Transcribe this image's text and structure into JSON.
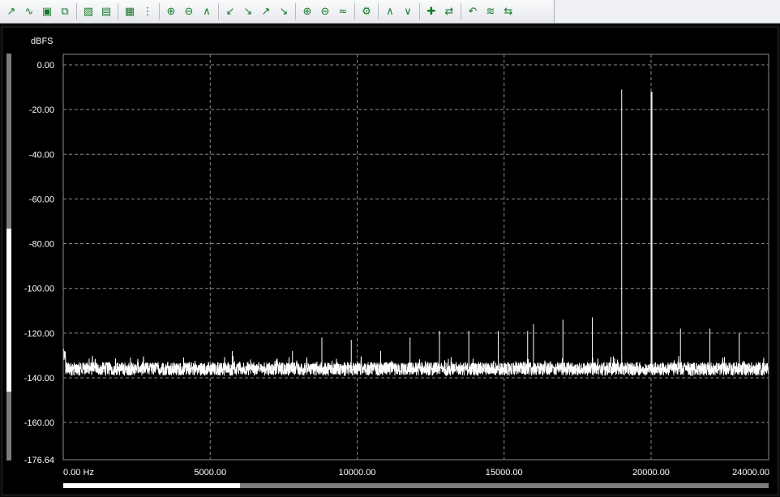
{
  "toolbar": {
    "buttons": [
      {
        "name": "add-trace-icon",
        "glyph": "↗"
      },
      {
        "name": "wave-icon",
        "glyph": "∿"
      },
      {
        "name": "save-icon",
        "glyph": "▣"
      },
      {
        "name": "copy-icon",
        "glyph": "⧉"
      },
      {
        "sep": true
      },
      {
        "name": "chart-view-icon",
        "glyph": "▨"
      },
      {
        "name": "print-icon",
        "glyph": "▤"
      },
      {
        "sep": true
      },
      {
        "name": "table-icon",
        "glyph": "▦"
      },
      {
        "name": "numeric-icon",
        "glyph": "⋮"
      },
      {
        "sep": true
      },
      {
        "name": "zoom-in-icon",
        "glyph": "⊕"
      },
      {
        "name": "zoom-out-icon",
        "glyph": "⊖"
      },
      {
        "name": "fit-icon",
        "glyph": "∧"
      },
      {
        "sep": true
      },
      {
        "name": "cursor-left-icon",
        "glyph": "↙"
      },
      {
        "name": "cursor-down-icon",
        "glyph": "↘"
      },
      {
        "name": "cursor-up-icon",
        "glyph": "↗"
      },
      {
        "name": "cursor-right-icon",
        "glyph": "↘"
      },
      {
        "sep": true
      },
      {
        "name": "zoom-x-icon",
        "glyph": "⊕"
      },
      {
        "name": "zoom-y-icon",
        "glyph": "⊖"
      },
      {
        "name": "autoscale-icon",
        "glyph": "≈"
      },
      {
        "sep": true
      },
      {
        "name": "settings-icon",
        "glyph": "⚙"
      },
      {
        "sep": true
      },
      {
        "name": "peak-icon",
        "glyph": "∧"
      },
      {
        "name": "valley-icon",
        "glyph": "∨"
      },
      {
        "sep": true
      },
      {
        "name": "reset-icon",
        "glyph": "✚"
      },
      {
        "name": "swap-icon",
        "glyph": "⇄"
      },
      {
        "sep": true
      },
      {
        "name": "undo-icon",
        "glyph": "↶"
      },
      {
        "name": "average-icon",
        "glyph": "≋"
      },
      {
        "name": "exchange-icon",
        "glyph": "⇆"
      }
    ]
  },
  "scroll": {
    "vertical_thumb": [
      0.43,
      0.83
    ],
    "horizontal_thumb": [
      0.0,
      0.25
    ]
  },
  "chart_data": {
    "type": "line",
    "title": "",
    "ylabel": "dBFS",
    "xunit": "Hz",
    "xlim": [
      0,
      24000
    ],
    "ylim": [
      -176.64,
      0
    ],
    "yticks": [
      0,
      -20,
      -40,
      -60,
      -80,
      -100,
      -120,
      -140,
      -160,
      -176.64
    ],
    "ytick_labels": [
      "0.00",
      "-20.00",
      "-40.00",
      "-60.00",
      "-80.00",
      "-100.00",
      "-120.00",
      "-140.00",
      "-160.00",
      "-176.64"
    ],
    "xticks": [
      0,
      5000,
      10000,
      15000,
      20000,
      24000
    ],
    "xtick_labels": [
      "0.00 Hz",
      "5000.00",
      "10000.00",
      "15000.00",
      "20000.00",
      "24000.00"
    ],
    "grid": true,
    "noise_floor_db": -136,
    "noise_spread_db": 3,
    "peaks": [
      {
        "x": 19000,
        "y": -11
      },
      {
        "x": 20000,
        "y": -12
      },
      {
        "x": 20030,
        "y": -12
      },
      {
        "x": 5750,
        "y": -128
      },
      {
        "x": 7800,
        "y": -128
      },
      {
        "x": 8800,
        "y": -122
      },
      {
        "x": 9800,
        "y": -123
      },
      {
        "x": 10800,
        "y": -128
      },
      {
        "x": 11800,
        "y": -122
      },
      {
        "x": 12800,
        "y": -119
      },
      {
        "x": 13800,
        "y": -119
      },
      {
        "x": 14800,
        "y": -119
      },
      {
        "x": 15800,
        "y": -119
      },
      {
        "x": 16000,
        "y": -116
      },
      {
        "x": 17000,
        "y": -114
      },
      {
        "x": 18000,
        "y": -113
      },
      {
        "x": 21000,
        "y": -118
      },
      {
        "x": 22000,
        "y": -118
      },
      {
        "x": 23000,
        "y": -120
      }
    ],
    "colors": {
      "background": "#000000",
      "grid": "#8a8a8a",
      "trace": "#ffffff",
      "axes_text": "#ffffff"
    }
  }
}
